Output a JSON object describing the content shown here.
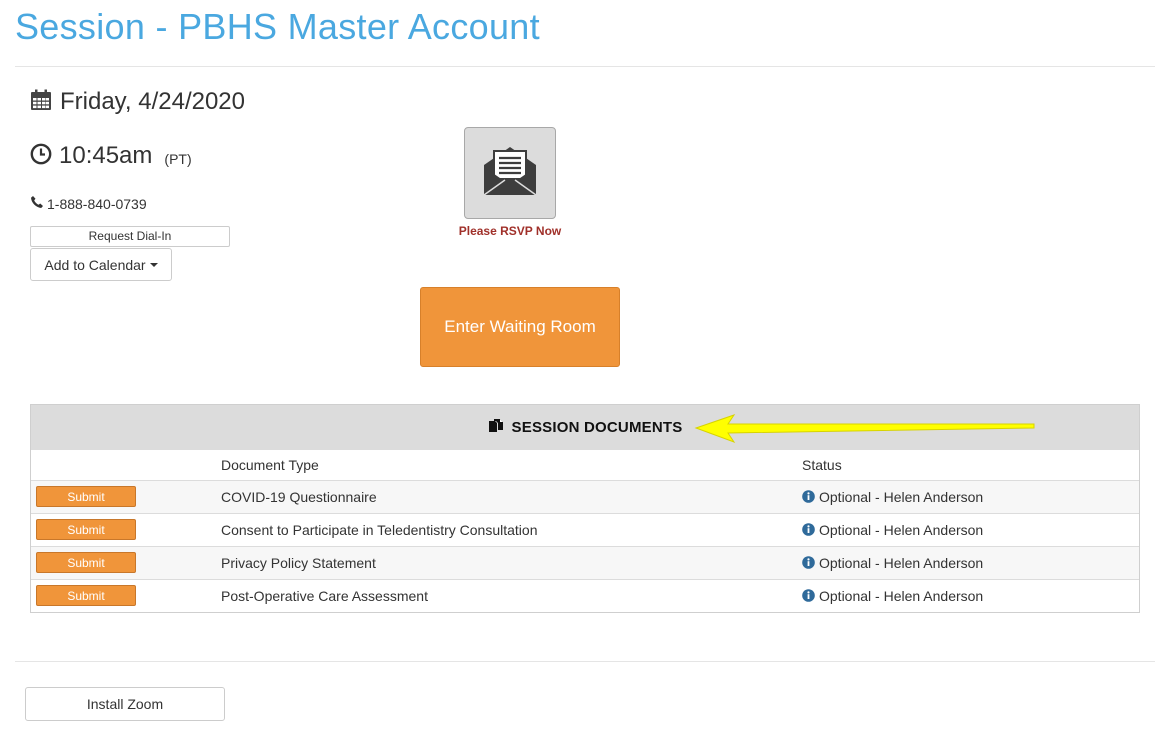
{
  "header": {
    "title": "Session - PBHS Master Account"
  },
  "session": {
    "date": "Friday, 4/24/2020",
    "time": "10:45am",
    "timezone": "(PT)",
    "phone": "1-888-840-0739"
  },
  "buttons": {
    "request_dialin": "Request Dial-In",
    "add_to_calendar": "Add to Calendar",
    "rsvp_label": "Please RSVP Now",
    "enter_waiting_room": "Enter Waiting Room",
    "install_zoom": "Install Zoom"
  },
  "documents": {
    "title": "SESSION DOCUMENTS",
    "columns": {
      "type": "Document Type",
      "status": "Status"
    },
    "rows": [
      {
        "action": "Submit",
        "type": "COVID-19 Questionnaire",
        "status": "Optional - Helen Anderson"
      },
      {
        "action": "Submit",
        "type": "Consent to Participate in Teledentistry Consultation",
        "status": "Optional - Helen Anderson"
      },
      {
        "action": "Submit",
        "type": "Privacy Policy Statement",
        "status": "Optional - Helen Anderson"
      },
      {
        "action": "Submit",
        "type": "Post-Operative Care Assessment",
        "status": "Optional - Helen Anderson"
      }
    ]
  },
  "icons": {
    "date": "calendar-icon",
    "time": "clock-icon",
    "phone": "phone-icon",
    "rsvp": "envelope-icon",
    "documents": "documents-icon",
    "status": "info-icon",
    "annotation": "arrow-icon"
  },
  "colors": {
    "title": "#4aa8e0",
    "accent": "#f0953a",
    "rsvp_text": "#a0302a",
    "info_icon": "#2f6a9a",
    "annotation_arrow": "#ffff00"
  }
}
